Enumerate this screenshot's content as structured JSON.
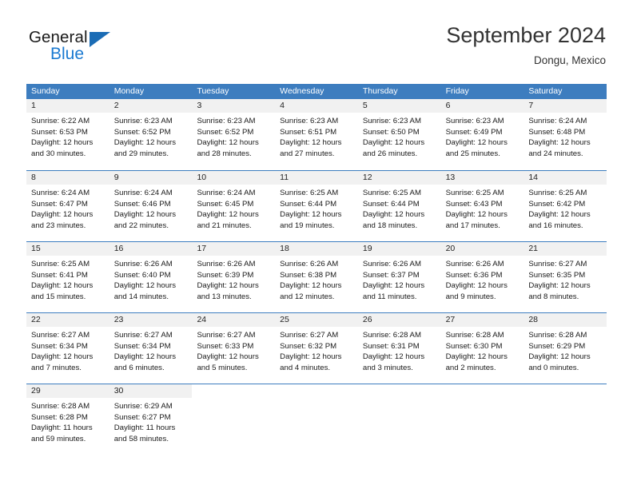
{
  "brand": {
    "name_primary": "General",
    "name_secondary": "Blue",
    "accent_color": "#1b7ad1",
    "triangle_color": "#1b6cb5"
  },
  "header": {
    "title": "September 2024",
    "location": "Dongu, Mexico"
  },
  "theme": {
    "header_bar_color": "#3d7dbf",
    "daynum_band_color": "#f1f1f1",
    "text_color": "#1a1a1a"
  },
  "weekdays": [
    "Sunday",
    "Monday",
    "Tuesday",
    "Wednesday",
    "Thursday",
    "Friday",
    "Saturday"
  ],
  "weeks": [
    [
      {
        "day": "1",
        "l1": "Sunrise: 6:22 AM",
        "l2": "Sunset: 6:53 PM",
        "l3": "Daylight: 12 hours",
        "l4": "and 30 minutes."
      },
      {
        "day": "2",
        "l1": "Sunrise: 6:23 AM",
        "l2": "Sunset: 6:52 PM",
        "l3": "Daylight: 12 hours",
        "l4": "and 29 minutes."
      },
      {
        "day": "3",
        "l1": "Sunrise: 6:23 AM",
        "l2": "Sunset: 6:52 PM",
        "l3": "Daylight: 12 hours",
        "l4": "and 28 minutes."
      },
      {
        "day": "4",
        "l1": "Sunrise: 6:23 AM",
        "l2": "Sunset: 6:51 PM",
        "l3": "Daylight: 12 hours",
        "l4": "and 27 minutes."
      },
      {
        "day": "5",
        "l1": "Sunrise: 6:23 AM",
        "l2": "Sunset: 6:50 PM",
        "l3": "Daylight: 12 hours",
        "l4": "and 26 minutes."
      },
      {
        "day": "6",
        "l1": "Sunrise: 6:23 AM",
        "l2": "Sunset: 6:49 PM",
        "l3": "Daylight: 12 hours",
        "l4": "and 25 minutes."
      },
      {
        "day": "7",
        "l1": "Sunrise: 6:24 AM",
        "l2": "Sunset: 6:48 PM",
        "l3": "Daylight: 12 hours",
        "l4": "and 24 minutes."
      }
    ],
    [
      {
        "day": "8",
        "l1": "Sunrise: 6:24 AM",
        "l2": "Sunset: 6:47 PM",
        "l3": "Daylight: 12 hours",
        "l4": "and 23 minutes."
      },
      {
        "day": "9",
        "l1": "Sunrise: 6:24 AM",
        "l2": "Sunset: 6:46 PM",
        "l3": "Daylight: 12 hours",
        "l4": "and 22 minutes."
      },
      {
        "day": "10",
        "l1": "Sunrise: 6:24 AM",
        "l2": "Sunset: 6:45 PM",
        "l3": "Daylight: 12 hours",
        "l4": "and 21 minutes."
      },
      {
        "day": "11",
        "l1": "Sunrise: 6:25 AM",
        "l2": "Sunset: 6:44 PM",
        "l3": "Daylight: 12 hours",
        "l4": "and 19 minutes."
      },
      {
        "day": "12",
        "l1": "Sunrise: 6:25 AM",
        "l2": "Sunset: 6:44 PM",
        "l3": "Daylight: 12 hours",
        "l4": "and 18 minutes."
      },
      {
        "day": "13",
        "l1": "Sunrise: 6:25 AM",
        "l2": "Sunset: 6:43 PM",
        "l3": "Daylight: 12 hours",
        "l4": "and 17 minutes."
      },
      {
        "day": "14",
        "l1": "Sunrise: 6:25 AM",
        "l2": "Sunset: 6:42 PM",
        "l3": "Daylight: 12 hours",
        "l4": "and 16 minutes."
      }
    ],
    [
      {
        "day": "15",
        "l1": "Sunrise: 6:25 AM",
        "l2": "Sunset: 6:41 PM",
        "l3": "Daylight: 12 hours",
        "l4": "and 15 minutes."
      },
      {
        "day": "16",
        "l1": "Sunrise: 6:26 AM",
        "l2": "Sunset: 6:40 PM",
        "l3": "Daylight: 12 hours",
        "l4": "and 14 minutes."
      },
      {
        "day": "17",
        "l1": "Sunrise: 6:26 AM",
        "l2": "Sunset: 6:39 PM",
        "l3": "Daylight: 12 hours",
        "l4": "and 13 minutes."
      },
      {
        "day": "18",
        "l1": "Sunrise: 6:26 AM",
        "l2": "Sunset: 6:38 PM",
        "l3": "Daylight: 12 hours",
        "l4": "and 12 minutes."
      },
      {
        "day": "19",
        "l1": "Sunrise: 6:26 AM",
        "l2": "Sunset: 6:37 PM",
        "l3": "Daylight: 12 hours",
        "l4": "and 11 minutes."
      },
      {
        "day": "20",
        "l1": "Sunrise: 6:26 AM",
        "l2": "Sunset: 6:36 PM",
        "l3": "Daylight: 12 hours",
        "l4": "and 9 minutes."
      },
      {
        "day": "21",
        "l1": "Sunrise: 6:27 AM",
        "l2": "Sunset: 6:35 PM",
        "l3": "Daylight: 12 hours",
        "l4": "and 8 minutes."
      }
    ],
    [
      {
        "day": "22",
        "l1": "Sunrise: 6:27 AM",
        "l2": "Sunset: 6:34 PM",
        "l3": "Daylight: 12 hours",
        "l4": "and 7 minutes."
      },
      {
        "day": "23",
        "l1": "Sunrise: 6:27 AM",
        "l2": "Sunset: 6:34 PM",
        "l3": "Daylight: 12 hours",
        "l4": "and 6 minutes."
      },
      {
        "day": "24",
        "l1": "Sunrise: 6:27 AM",
        "l2": "Sunset: 6:33 PM",
        "l3": "Daylight: 12 hours",
        "l4": "and 5 minutes."
      },
      {
        "day": "25",
        "l1": "Sunrise: 6:27 AM",
        "l2": "Sunset: 6:32 PM",
        "l3": "Daylight: 12 hours",
        "l4": "and 4 minutes."
      },
      {
        "day": "26",
        "l1": "Sunrise: 6:28 AM",
        "l2": "Sunset: 6:31 PM",
        "l3": "Daylight: 12 hours",
        "l4": "and 3 minutes."
      },
      {
        "day": "27",
        "l1": "Sunrise: 6:28 AM",
        "l2": "Sunset: 6:30 PM",
        "l3": "Daylight: 12 hours",
        "l4": "and 2 minutes."
      },
      {
        "day": "28",
        "l1": "Sunrise: 6:28 AM",
        "l2": "Sunset: 6:29 PM",
        "l3": "Daylight: 12 hours",
        "l4": "and 0 minutes."
      }
    ],
    [
      {
        "day": "29",
        "l1": "Sunrise: 6:28 AM",
        "l2": "Sunset: 6:28 PM",
        "l3": "Daylight: 11 hours",
        "l4": "and 59 minutes."
      },
      {
        "day": "30",
        "l1": "Sunrise: 6:29 AM",
        "l2": "Sunset: 6:27 PM",
        "l3": "Daylight: 11 hours",
        "l4": "and 58 minutes."
      },
      {
        "day": "",
        "l1": "",
        "l2": "",
        "l3": "",
        "l4": ""
      },
      {
        "day": "",
        "l1": "",
        "l2": "",
        "l3": "",
        "l4": ""
      },
      {
        "day": "",
        "l1": "",
        "l2": "",
        "l3": "",
        "l4": ""
      },
      {
        "day": "",
        "l1": "",
        "l2": "",
        "l3": "",
        "l4": ""
      },
      {
        "day": "",
        "l1": "",
        "l2": "",
        "l3": "",
        "l4": ""
      }
    ]
  ]
}
